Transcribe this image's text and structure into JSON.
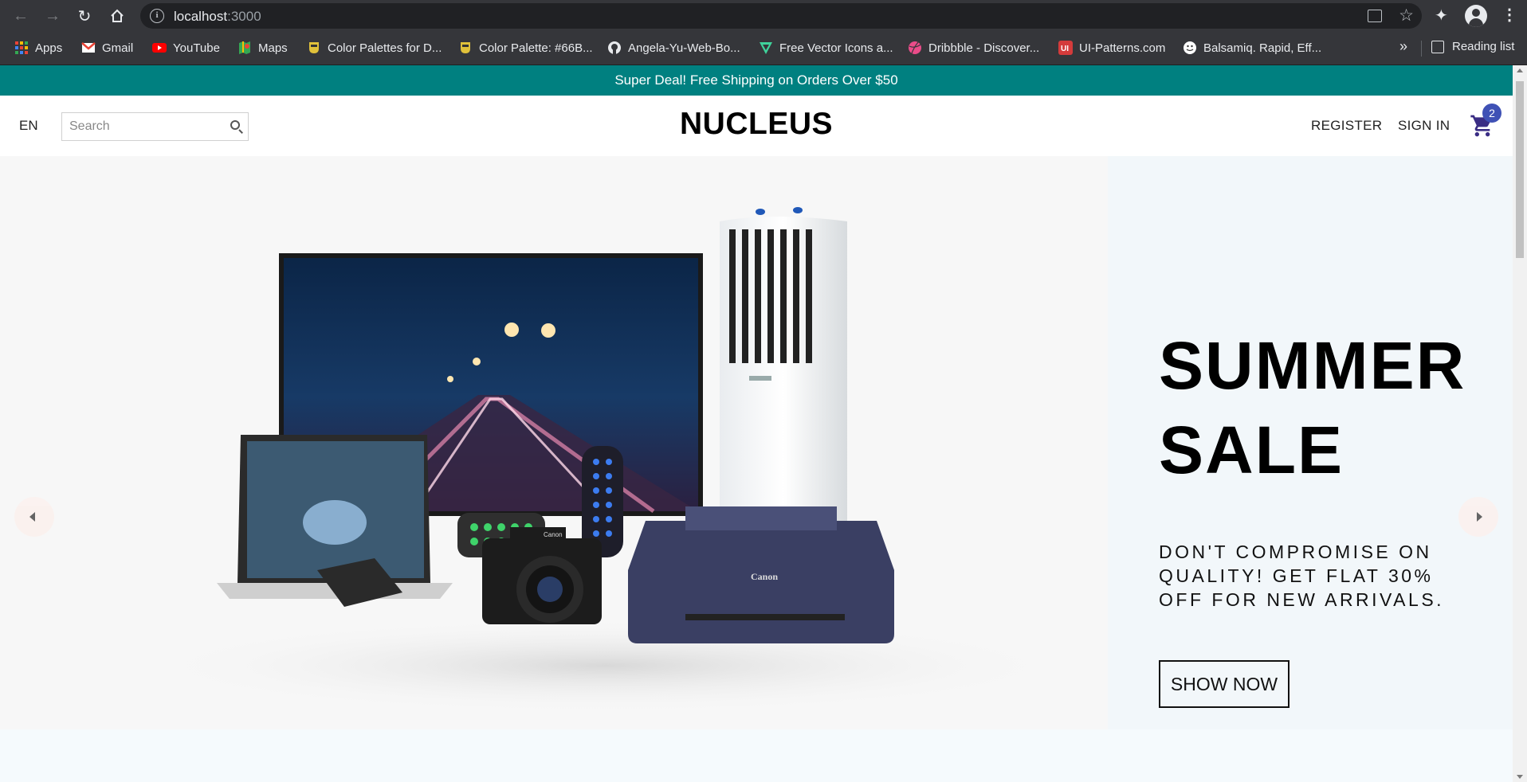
{
  "browser": {
    "url_host": "localhost",
    "url_port": ":3000",
    "bookmarks": [
      {
        "label": "Apps",
        "icon": "apps-grid-icon",
        "color": "#ea4335"
      },
      {
        "label": "Gmail",
        "icon": "gmail-icon",
        "color": "#ea4335"
      },
      {
        "label": "YouTube",
        "icon": "youtube-icon",
        "color": "#ff0000"
      },
      {
        "label": "Maps",
        "icon": "maps-icon",
        "color": "#34a853"
      },
      {
        "label": "Color Palettes for D...",
        "icon": "palette-icon",
        "color": "#e0c13a"
      },
      {
        "label": "Color Palette: #66B...",
        "icon": "palette-icon",
        "color": "#e0c13a"
      },
      {
        "label": "Angela-Yu-Web-Bo...",
        "icon": "github-icon",
        "color": "#e8eaed"
      },
      {
        "label": "Free Vector Icons a...",
        "icon": "vector-icon",
        "color": "#3fd39b"
      },
      {
        "label": "Dribbble - Discover...",
        "icon": "dribbble-icon",
        "color": "#ea4c89"
      },
      {
        "label": "UI-Patterns.com",
        "icon": "ui-patterns-icon",
        "color": "#d43b3b"
      },
      {
        "label": "Balsamiq. Rapid, Eff...",
        "icon": "balsamiq-icon",
        "color": "#ffffff"
      }
    ],
    "reading_list": "Reading list"
  },
  "announcement": "Super Deal! Free Shipping on Orders Over $50",
  "navbar": {
    "language": "EN",
    "search_placeholder": "Search",
    "logo": "NUCLEUS",
    "register": "REGISTER",
    "sign_in": "SIGN IN",
    "cart_count": "2"
  },
  "slide": {
    "title_line1": "SUMMER",
    "title_line2": "SALE",
    "description": "DON'T COMPROMISE ON QUALITY! GET FLAT 30% OFF FOR NEW ARRIVALS.",
    "button": "SHOW NOW"
  },
  "colors": {
    "announcement_bg": "#008080",
    "cart": "#3a2d84",
    "badge": "#3f51b5"
  }
}
